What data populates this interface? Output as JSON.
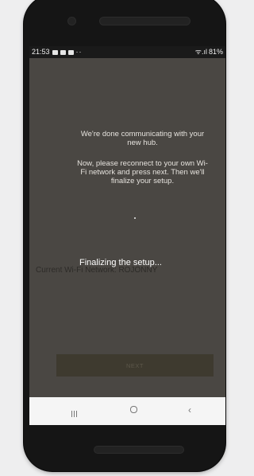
{
  "status_bar": {
    "time": "21:53",
    "notification_icons": [
      "image-icon",
      "mail-icon",
      "mail-icon"
    ],
    "more": "··",
    "signal": "ᯤ.ıl",
    "battery": "81%"
  },
  "message": {
    "line1": "We're done communicating with your new hub.",
    "line2": "Now, please reconnect to your own Wi-Fi network and press next. Then we'll finalize your setup."
  },
  "network": {
    "label": "Current Wi-Fi Network: ROJONNY"
  },
  "overlay": {
    "text": "Finalizing the setup..."
  },
  "actions": {
    "next_label": "NEXT"
  },
  "colors": {
    "screen_bg": "#4a4743",
    "button_bg": "#3e3a2f",
    "nav_bg": "#f5f5f5"
  }
}
